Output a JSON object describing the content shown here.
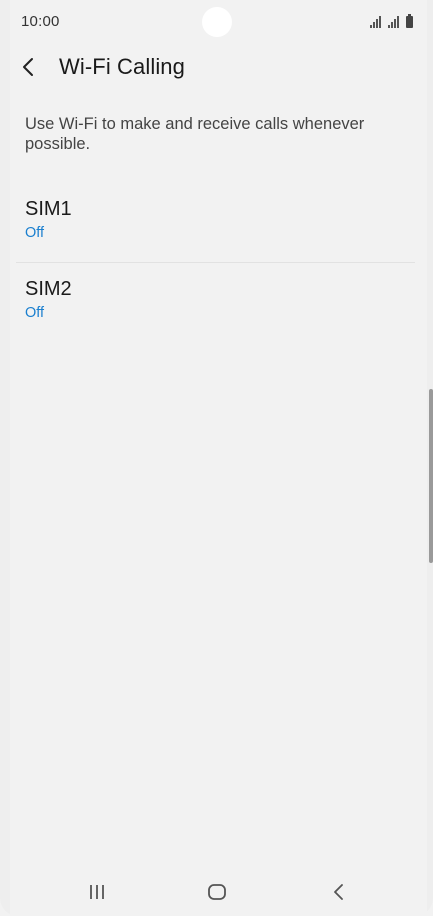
{
  "status_bar": {
    "time": "10:00",
    "icons": [
      "signal-sim1-icon",
      "signal-sim2-icon",
      "battery-icon"
    ]
  },
  "header": {
    "back_icon": "chevron-left-icon",
    "title": "Wi-Fi Calling"
  },
  "description": "Use Wi-Fi to make and receive calls whenever possible.",
  "sims": [
    {
      "name": "SIM1",
      "status": "Off"
    },
    {
      "name": "SIM2",
      "status": "Off"
    }
  ],
  "colors": {
    "background": "#f2f2f2",
    "accent": "#1a7fcf",
    "text_primary": "#1a1a1a",
    "text_secondary": "#444444"
  },
  "nav_bar": {
    "items": [
      "recent-apps-icon",
      "home-icon",
      "back-icon"
    ]
  }
}
